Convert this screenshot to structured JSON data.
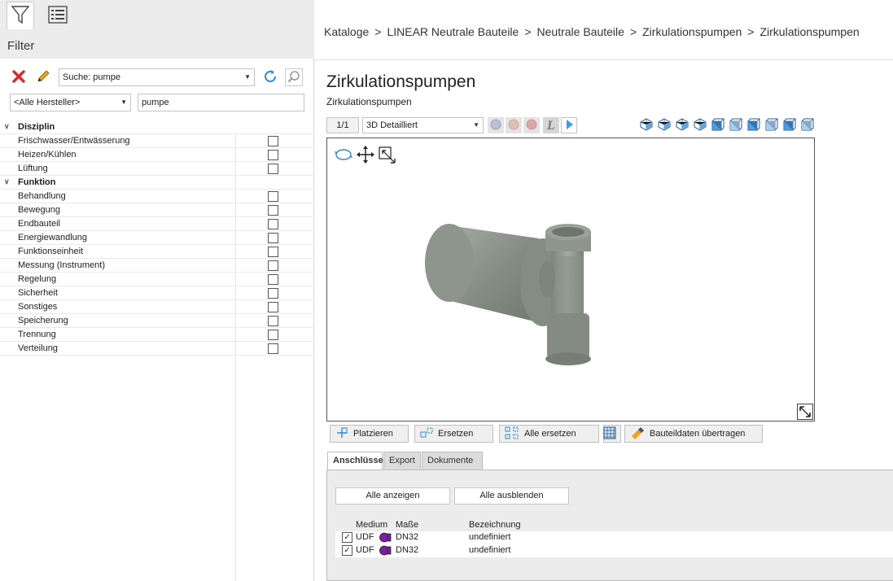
{
  "left": {
    "title": "Filter",
    "search_combo": "Suche: pumpe",
    "manufacturer_combo": "<Alle Hersteller>",
    "search_text": "pumpe",
    "tree": [
      {
        "label": "Disziplin",
        "group": true
      },
      {
        "label": "Frischwasser/Entwässerung",
        "group": false
      },
      {
        "label": "Heizen/Kühlen",
        "group": false
      },
      {
        "label": "Lüftung",
        "group": false
      },
      {
        "label": "Funktion",
        "group": true
      },
      {
        "label": "Behandlung",
        "group": false
      },
      {
        "label": "Bewegung",
        "group": false
      },
      {
        "label": "Endbauteil",
        "group": false
      },
      {
        "label": "Energiewandlung",
        "group": false
      },
      {
        "label": "Funktionseinheit",
        "group": false
      },
      {
        "label": "Messung (Instrument)",
        "group": false
      },
      {
        "label": "Regelung",
        "group": false
      },
      {
        "label": "Sicherheit",
        "group": false
      },
      {
        "label": "Sonstiges",
        "group": false
      },
      {
        "label": "Speicherung",
        "group": false
      },
      {
        "label": "Trennung",
        "group": false
      },
      {
        "label": "Verteilung",
        "group": false
      }
    ]
  },
  "breadcrumb": [
    "Kataloge",
    "LINEAR Neutrale Bauteile",
    "Neutrale Bauteile",
    "Zirkulationspumpen",
    "Zirkulationspumpen"
  ],
  "breadcrumb_sep": ">",
  "title": "Zirkulationspumpen",
  "subtitle": "Zirkulationspumpen",
  "viewer": {
    "page": "1/1",
    "mode": "3D Detailliert"
  },
  "actions": {
    "place": "Platzieren",
    "replace": "Ersetzen",
    "replace_all": "Alle ersetzen",
    "transfer": "Bauteildaten übertragen"
  },
  "tabs": [
    "Anschlüsse",
    "Export",
    "Dokumente"
  ],
  "connections": {
    "show_all": "Alle anzeigen",
    "hide_all": "Alle ausblenden",
    "headers": {
      "medium": "Medium",
      "dims": "Maße",
      "name": "Bezeichnung"
    },
    "rows": [
      {
        "checked": true,
        "medium": "UDF",
        "dims": "DN32",
        "name": "undefiniert"
      },
      {
        "checked": true,
        "medium": "UDF",
        "dims": "DN32",
        "name": "undefiniert"
      }
    ]
  },
  "colors": {
    "accent": "#2a8ad4",
    "delete": "#d42a2a",
    "medium_dot": "#7a1fa2",
    "model": "#8a9189"
  }
}
